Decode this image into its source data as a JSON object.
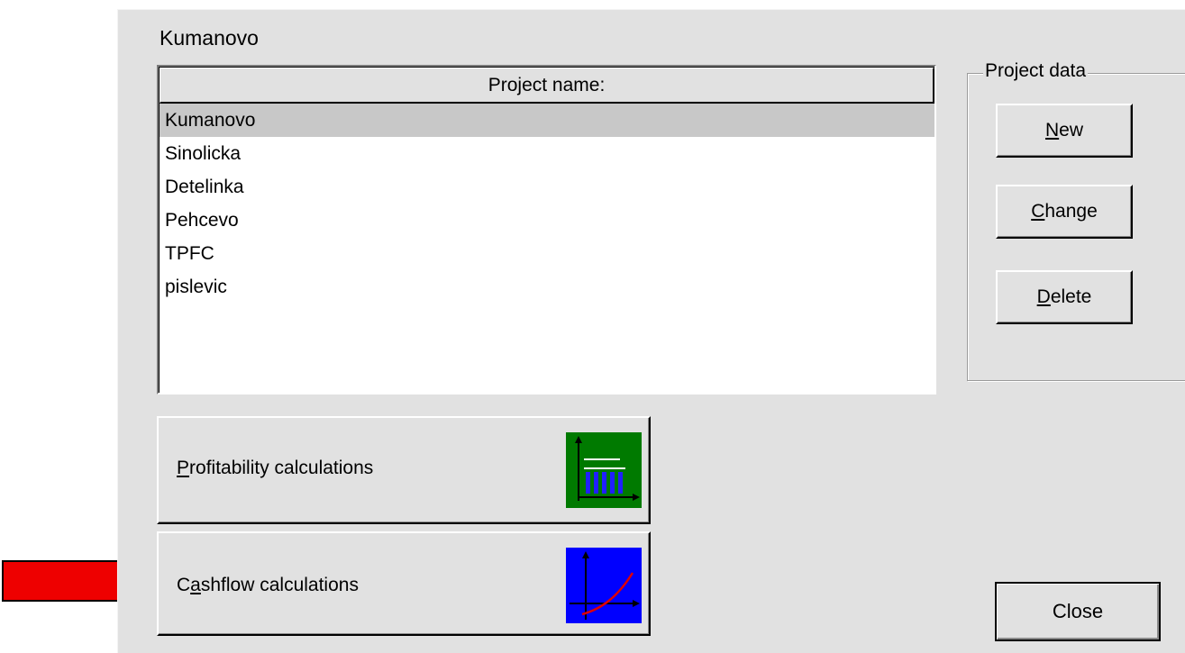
{
  "dialog": {
    "current_project": "Kumanovo",
    "list_header": "Project name:",
    "projects": [
      "Kumanovo",
      "Sinolicka",
      "Detelinka",
      "Pehcevo",
      "TPFC",
      "pislevic"
    ],
    "selected_project": "Kumanovo",
    "group_label": "Project data",
    "buttons": {
      "new": {
        "label": "New",
        "mnemonic": "N"
      },
      "change": {
        "label": "Change",
        "mnemonic": "C"
      },
      "delete": {
        "label": "Delete",
        "mnemonic": "D"
      },
      "profitability": {
        "label": "Profitability calculations",
        "mnemonic": "P",
        "icon": "bar-chart-icon",
        "icon_bg": "#007a00"
      },
      "cashflow": {
        "label": "Cashflow calculations",
        "mnemonic": "a",
        "icon": "curve-chart-icon",
        "icon_bg": "#0000ff"
      },
      "close": {
        "label": "Close"
      }
    }
  },
  "annotation": {
    "arrow_color": "#ee0000",
    "icon": "red-arrow-icon"
  }
}
